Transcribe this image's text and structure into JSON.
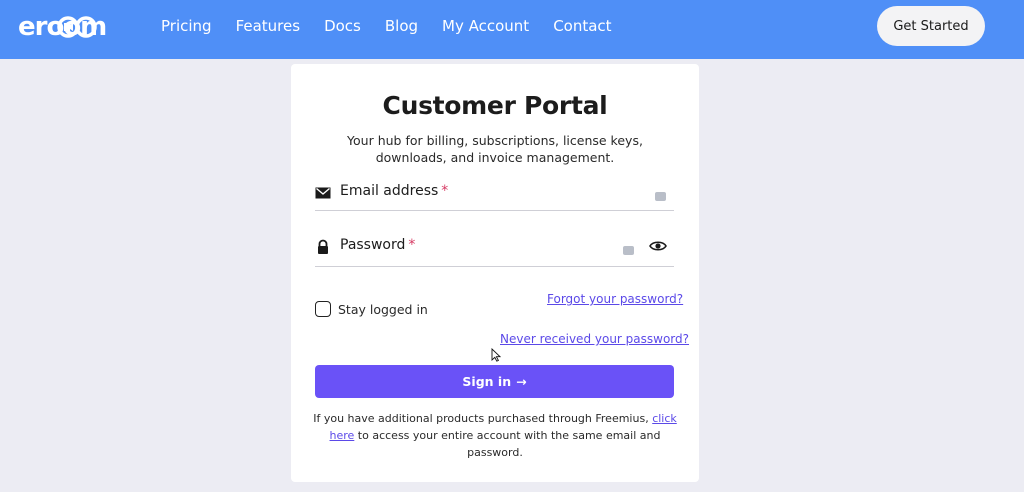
{
  "header": {
    "logo_text": "eroom",
    "nav": [
      "Pricing",
      "Features",
      "Docs",
      "Blog",
      "My Account",
      "Contact"
    ],
    "cta_label": "Get Started",
    "bg_color": "#4f8ff7"
  },
  "card": {
    "title": "Customer Portal",
    "subtitle": "Your hub for billing, subscriptions, license keys, downloads, and invoice management.",
    "email": {
      "label": "Email address",
      "required_mark": "*",
      "icon": "envelope-icon"
    },
    "password": {
      "label": "Password",
      "required_mark": "*",
      "icon": "lock-icon"
    },
    "stay_logged_in": {
      "label": "Stay logged in",
      "checked": false
    },
    "forgot_link": "Forgot your password?",
    "never_received_link": "Never received your password?",
    "signin": {
      "label": "Sign in",
      "arrow": "→",
      "color": "#6a52f7"
    },
    "footer": {
      "pre": "If you have additional products purchased through Freemius, ",
      "link": "click here",
      "post": " to access your entire account with the same email and password."
    }
  }
}
